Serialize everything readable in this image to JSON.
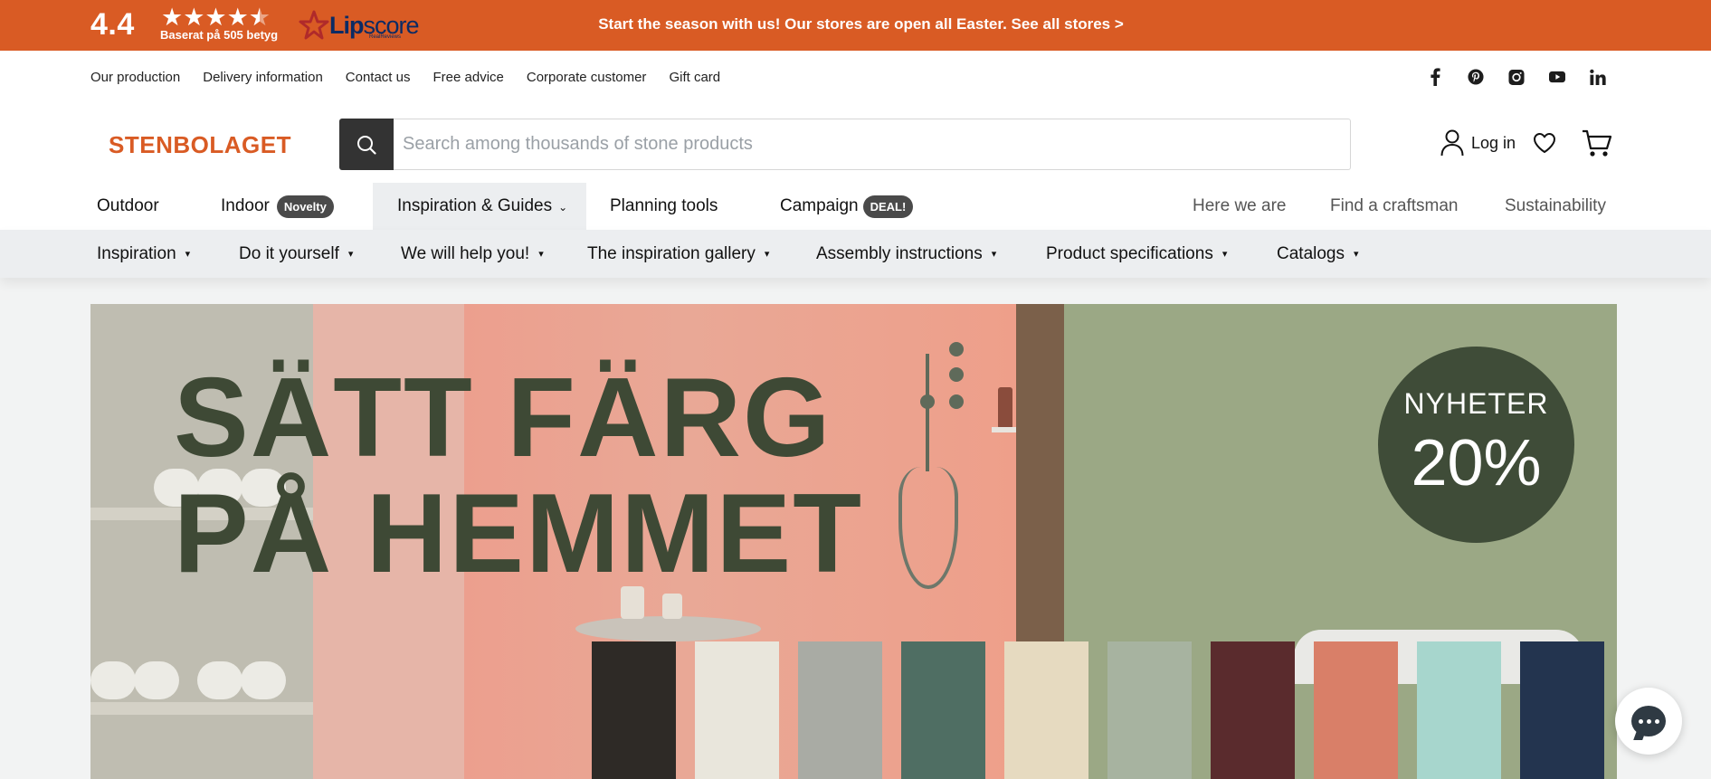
{
  "rating": {
    "score": "4.4",
    "stars": "★★★★",
    "half_star": "★",
    "based_on": "Baserat på 505 betyg",
    "provider_part1": "Lip",
    "provider_part2": "score",
    "provider_tag": "RealReviews"
  },
  "announcement": "Start the season with us! Our stores are open all Easter. See all stores >",
  "util_links": [
    "Our production",
    "Delivery information",
    "Contact us",
    "Free advice",
    "Corporate customer",
    "Gift card"
  ],
  "socials": [
    "facebook-icon",
    "pinterest-icon",
    "instagram-icon",
    "youtube-icon",
    "linkedin-icon"
  ],
  "header": {
    "logo": "STENBOLAGET",
    "search_placeholder": "Search among thousands of stone products",
    "login_label": "Log in"
  },
  "main_nav": {
    "outdoor": "Outdoor",
    "indoor": "Indoor",
    "indoor_badge": "Novelty",
    "inspiration": "Inspiration & Guides",
    "planning": "Planning tools",
    "campaign": "Campaign",
    "campaign_badge": "DEAL!",
    "here": "Here we are",
    "craftsman": "Find a craftsman",
    "sustainability": "Sustainability"
  },
  "sub_nav": [
    "Inspiration",
    "Do it yourself",
    "We will help you!",
    "The inspiration gallery",
    "Assembly instructions",
    "Product specifications",
    "Catalogs"
  ],
  "hero": {
    "title_line1": "SÄTT FÄRG",
    "title_line2": "PÅ HEMMET",
    "badge_top": "NYHETER",
    "badge_value": "20%"
  },
  "colors": {
    "brand_orange": "#d95b24",
    "dark_green": "#3e4935"
  },
  "tiles": [
    "#2e2a26",
    "#e9e6dc",
    "#a9aba4",
    "#4f6e63",
    "#e6dac0",
    "#a7b3a0",
    "#5a2b2d",
    "#d97f68",
    "#a7d6cd",
    "#23344f"
  ]
}
